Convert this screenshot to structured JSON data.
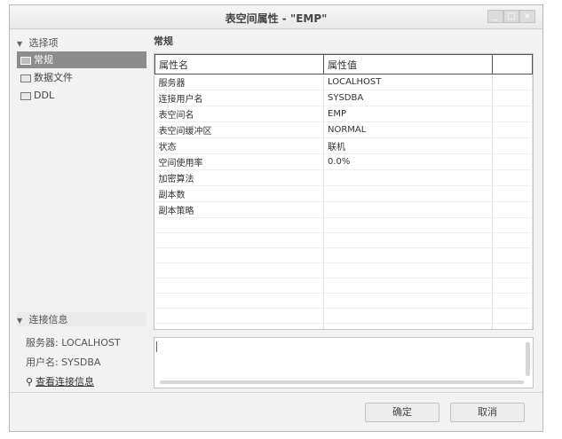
{
  "window": {
    "title": "表空间属性 - \"EMP\"",
    "controls": {
      "minimize": "_",
      "maximize": "□",
      "close": "×"
    }
  },
  "sidebar": {
    "options_header": "选择项",
    "items": [
      {
        "label": "常规",
        "selected": true
      },
      {
        "label": "数据文件",
        "selected": false
      },
      {
        "label": "DDL",
        "selected": false
      }
    ],
    "connection_header": "连接信息",
    "server_line": "服务器: LOCALHOST",
    "user_line": "用户名: SYSDBA",
    "view_link": "查看连接信息"
  },
  "main": {
    "section_label": "常规",
    "columns": [
      "属性名",
      "属性值",
      ""
    ],
    "rows": [
      [
        "服务器",
        "LOCALHOST"
      ],
      [
        "连接用户名",
        "SYSDBA"
      ],
      [
        "表空间名",
        "EMP"
      ],
      [
        "表空间缓冲区",
        "NORMAL"
      ],
      [
        "状态",
        "联机"
      ],
      [
        "空间使用率",
        "0.0%"
      ],
      [
        "加密算法",
        ""
      ],
      [
        "副本数",
        ""
      ],
      [
        "副本策略",
        ""
      ]
    ],
    "empty_rows": 10
  },
  "buttons": {
    "ok": "确定",
    "cancel": "取消"
  },
  "colors": {
    "selected_bg": "#8c8c8c",
    "window_bg": "#f2f2f2"
  }
}
